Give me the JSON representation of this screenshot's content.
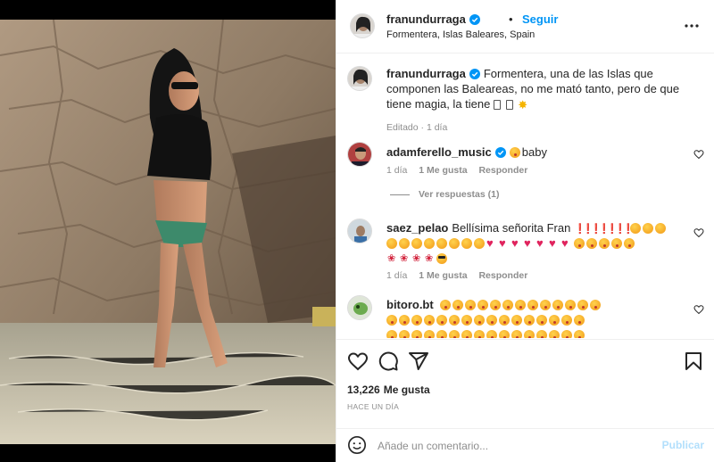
{
  "post": {
    "username": "franundurraga",
    "follow_label": "Seguir",
    "dot": "•",
    "location": "Formentera, Islas Baleares, Spain"
  },
  "caption": {
    "username": "franundurraga",
    "text": "Formentera, una de las Islas que componen las Baleareas, no me mató tanto, pero de que tiene magia, la tiene",
    "meta": "Editado · 1 día"
  },
  "comments": [
    {
      "username": "adamferello_music",
      "text": "baby",
      "time": "1 día",
      "likes": "1 Me gusta",
      "reply": "Responder",
      "view_replies": "Ver respuestas (1)"
    },
    {
      "username": "saez_pelao",
      "text": "Bellísima señorita Fran",
      "time": "1 día",
      "likes": "1 Me gusta",
      "reply": "Responder"
    },
    {
      "username": "bitoro.bt",
      "text": "",
      "time": "",
      "likes": "",
      "reply": ""
    }
  ],
  "actions": {
    "likes_count": "13,226",
    "likes_label": "Me gusta",
    "time_ago": "HACE UN DÍA"
  },
  "composer": {
    "placeholder": "Añade un comentario...",
    "publish_label": "Publicar"
  },
  "colors": {
    "accent": "#0095f6",
    "publish_disabled": "#b2dffc",
    "muted": "#8e8e8e",
    "text": "#262626",
    "border": "#efefef"
  },
  "icons": [
    "verified-badge-icon",
    "more-options-icon",
    "heart-icon",
    "comment-icon",
    "share-icon",
    "bookmark-icon",
    "emoji-icon"
  ]
}
